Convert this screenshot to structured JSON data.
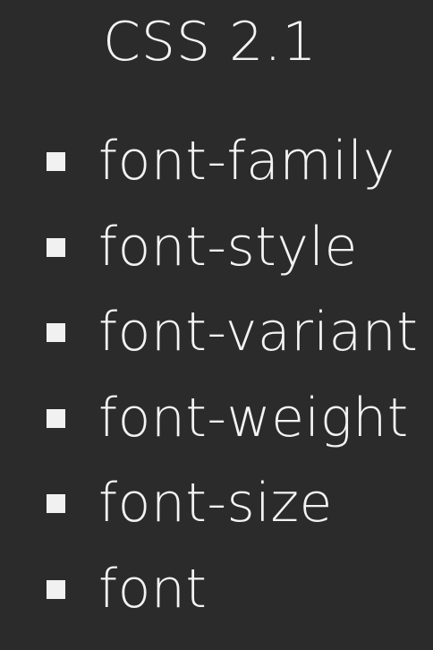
{
  "slide": {
    "title": "CSS 2.1",
    "items": [
      {
        "label": "font-family",
        "marker": "square-bullet-icon"
      },
      {
        "label": "font-style",
        "marker": "square-bullet-icon"
      },
      {
        "label": "font-variant",
        "marker": "square-bullet-icon"
      },
      {
        "label": "font-weight",
        "marker": "square-bullet-icon"
      },
      {
        "label": "font-size",
        "marker": "square-bullet-icon"
      },
      {
        "label": "font",
        "marker": "square-bullet-icon"
      }
    ]
  },
  "colors": {
    "background": "#2b2b2b",
    "text": "#f3f3f3",
    "bullet": "#f1f1f1"
  }
}
